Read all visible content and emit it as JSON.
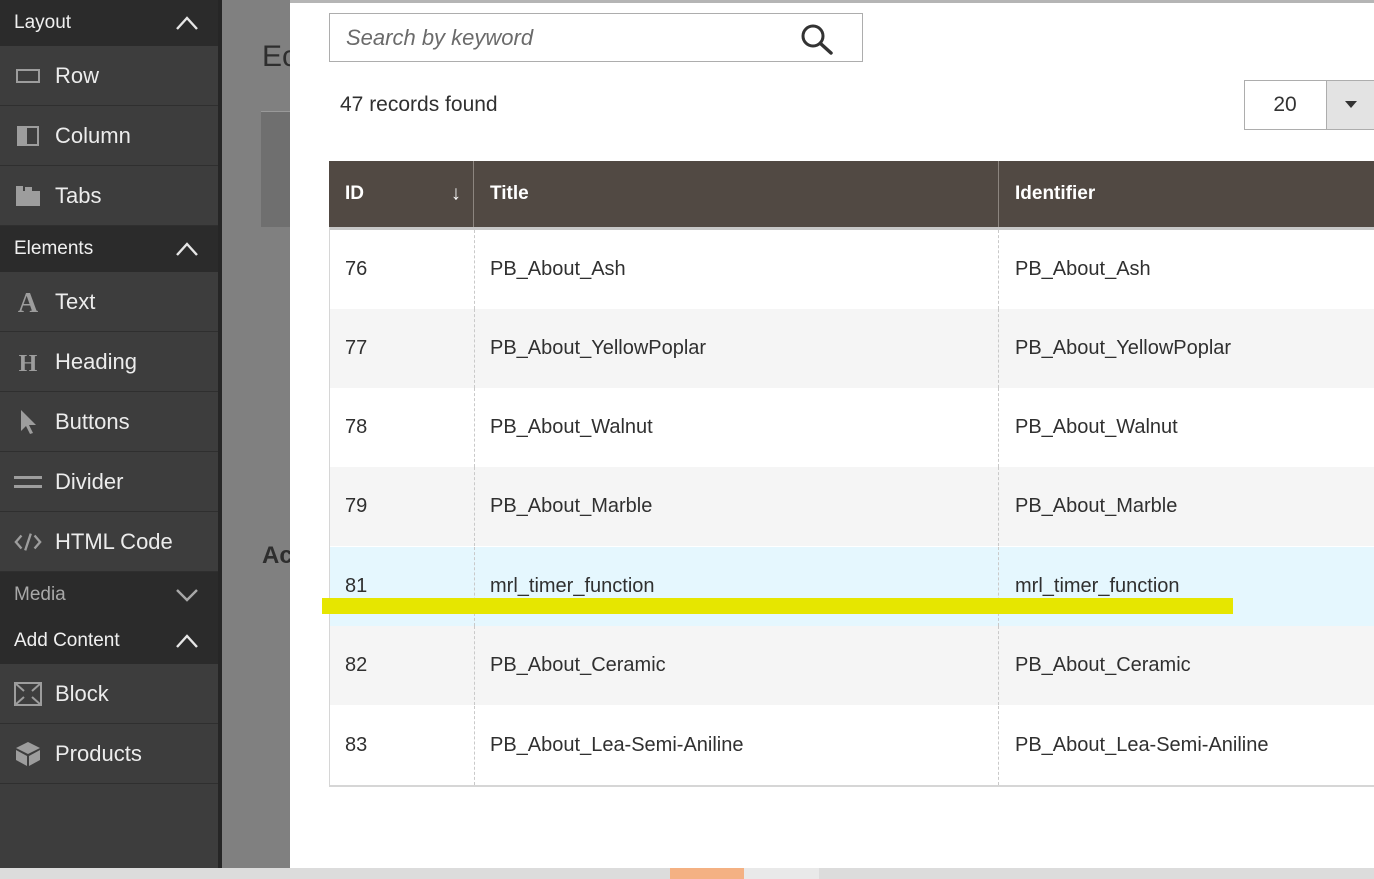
{
  "sidebar": {
    "groups": [
      {
        "title": "Layout",
        "expanded": true,
        "items": [
          {
            "label": "Row",
            "icon": "row-icon"
          },
          {
            "label": "Column",
            "icon": "column-icon"
          },
          {
            "label": "Tabs",
            "icon": "tabs-icon"
          }
        ]
      },
      {
        "title": "Elements",
        "expanded": true,
        "items": [
          {
            "label": "Text",
            "icon": "text-icon"
          },
          {
            "label": "Heading",
            "icon": "heading-icon"
          },
          {
            "label": "Buttons",
            "icon": "pointer-icon"
          },
          {
            "label": "Divider",
            "icon": "divider-icon"
          },
          {
            "label": "HTML Code",
            "icon": "code-icon"
          }
        ]
      },
      {
        "title": "Media",
        "expanded": false,
        "items": []
      },
      {
        "title": "Add Content",
        "expanded": true,
        "items": [
          {
            "label": "Block",
            "icon": "block-icon"
          },
          {
            "label": "Products",
            "icon": "products-icon"
          }
        ]
      }
    ]
  },
  "background": {
    "title_fragment": "Ec",
    "section_fragment": "Ac"
  },
  "modal": {
    "search": {
      "placeholder": "Search by keyword",
      "value": ""
    },
    "records_found": "47 records found",
    "per_page": "20",
    "grid": {
      "columns": [
        {
          "label": "ID",
          "sort": "↓"
        },
        {
          "label": "Title"
        },
        {
          "label": "Identifier"
        }
      ],
      "rows": [
        {
          "id": "76",
          "title": "PB_About_Ash",
          "identifier": "PB_About_Ash"
        },
        {
          "id": "77",
          "title": "PB_About_YellowPoplar",
          "identifier": "PB_About_YellowPoplar"
        },
        {
          "id": "78",
          "title": "PB_About_Walnut",
          "identifier": "PB_About_Walnut"
        },
        {
          "id": "79",
          "title": "PB_About_Marble",
          "identifier": "PB_About_Marble"
        },
        {
          "id": "81",
          "title": "mrl_timer_function",
          "identifier": "mrl_timer_function",
          "selected": true
        },
        {
          "id": "82",
          "title": "PB_About_Ceramic",
          "identifier": "PB_About_Ceramic"
        },
        {
          "id": "83",
          "title": "PB_About_Lea-Semi-Aniline",
          "identifier": "PB_About_Lea-Semi-Aniline"
        }
      ]
    }
  },
  "colors": {
    "header_bg": "#514943",
    "sidebar_bg": "#3d3d3d",
    "selected_row": "#e5f7fe",
    "highlight_mark": "#e6e600"
  }
}
